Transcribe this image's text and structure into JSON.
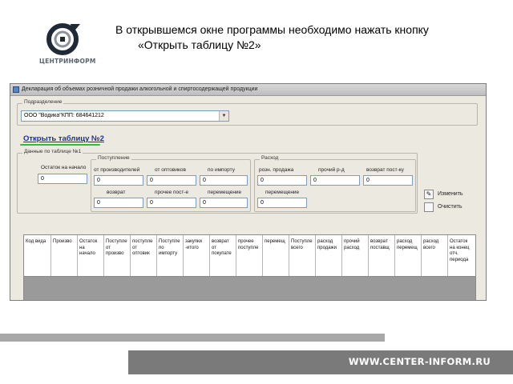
{
  "logo": {
    "text": "ЦЕНТРИНФОРМ",
    "icon": "centrinform-logo"
  },
  "header": {
    "line1": "В открывшемся окне программы необходимо нажать кнопку",
    "line2": "«Открыть таблицу №2»"
  },
  "window": {
    "title": "Декларация об объемах розничной продажи алкогольной и спиртосодержащей продукции",
    "subdivision": {
      "legend": "Подразделение",
      "value": "ООО \"Водика\"КПП: 684641212"
    },
    "open_table_link": "Открыть таблицу №2",
    "data_group": {
      "legend": "Данные по таблице №1",
      "start_label": "Остаток на начало",
      "start_value": "0"
    },
    "income_group": {
      "legend": "Поступление",
      "labels_row1": [
        "от производителей",
        "от оптовиков",
        "по импорту"
      ],
      "values_row1": [
        "0",
        "0",
        "0"
      ],
      "labels_row2": [
        "возврат",
        "прочее пост-е",
        "перемещение"
      ],
      "values_row2": [
        "0",
        "0",
        "0"
      ]
    },
    "expense_group": {
      "legend": "Расход",
      "labels_row1": [
        "розн. продажа",
        "прочий р-д",
        "возврат пост-ку"
      ],
      "values_row1": [
        "0",
        "0",
        "0"
      ],
      "labels_row2": [
        "перемещение"
      ],
      "values_row2": [
        "0"
      ]
    },
    "buttons": {
      "edit": "Изменить",
      "clear": "Очистить"
    },
    "grid_columns": [
      "Код вида",
      "Произво",
      "Остаток на начало",
      "Поступле от произво",
      "поступле от оптовик",
      "Поступле по импорту",
      "закупки -итого",
      "возврат от покупате",
      "прочее поступле",
      "перемещ",
      "Поступле всего",
      "расход продажи",
      "прочий расход",
      "возврат поставщ",
      "расход перемещ",
      "расход всего",
      "Остаток на конец отч. периода"
    ]
  },
  "footer": {
    "url": "WWW.CENTER-INFORM.RU"
  }
}
